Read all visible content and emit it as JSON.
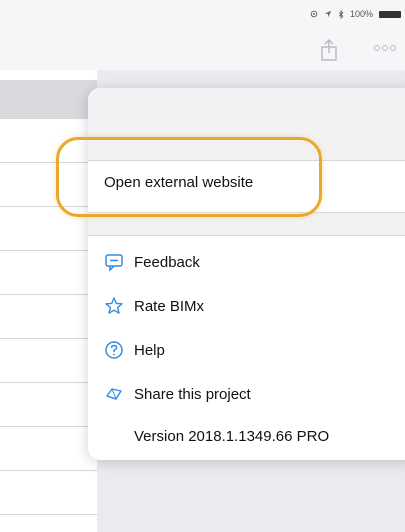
{
  "status_bar": {
    "battery": "100%"
  },
  "nav_bar": {
    "share_icon": "share-icon",
    "more_icon": "more-dots-icon"
  },
  "menu": {
    "open_external": "Open external website",
    "feedback": "Feedback",
    "rate": "Rate BIMx",
    "help": "Help",
    "share_project": "Share this project",
    "version": "Version 2018.1.1349.66 PRO"
  },
  "colors": {
    "accent_icon": "#2f8de4",
    "highlight": "#e8a92a"
  }
}
